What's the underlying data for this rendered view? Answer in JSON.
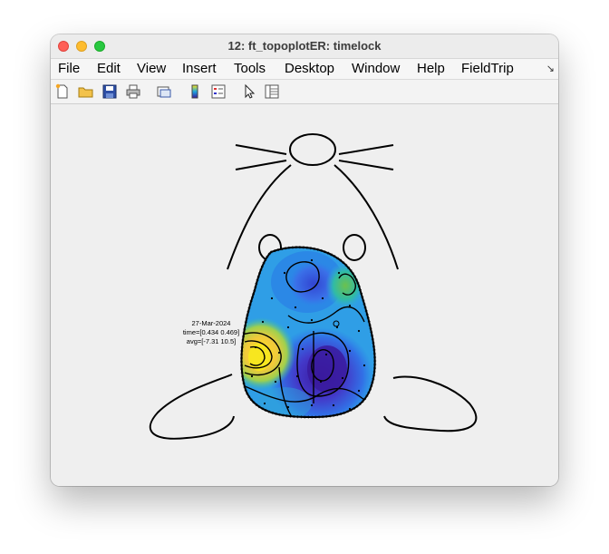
{
  "window": {
    "title": "12: ft_topoplotER: timelock"
  },
  "menubar": {
    "items": [
      "File",
      "Edit",
      "View",
      "Insert",
      "Tools",
      "Desktop",
      "Window",
      "Help",
      "FieldTrip"
    ],
    "overflow_icon": "menu-overflow-arrow-icon"
  },
  "toolbar": {
    "icons": [
      "new-figure-icon",
      "open-file-icon",
      "save-icon",
      "print-icon",
      "link-plot-icon",
      "colorbar-icon",
      "legend-icon",
      "edit-plot-pointer-icon",
      "property-inspector-icon"
    ]
  },
  "plot": {
    "annotation": {
      "date": "27-Mar-2024",
      "time": "time=[0.434 0.469]",
      "avg": "avg=[-7.31 10.5]"
    },
    "colors": {
      "low": "#3a1a9e",
      "mid": "#1fa6e0",
      "high": "#f7e61f",
      "outline": "#000000"
    }
  }
}
